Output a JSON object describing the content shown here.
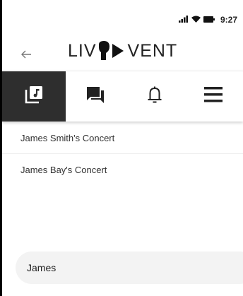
{
  "status_bar": {
    "time": "9:27",
    "signal_icon": "signal-icon",
    "wifi_icon": "wifi-icon",
    "battery_icon": "battery-icon"
  },
  "header": {
    "back_icon": "arrow-left-icon",
    "logo_left": "LIV",
    "logo_right": "VENT"
  },
  "tabs": [
    {
      "icon": "music-library-icon",
      "active": true
    },
    {
      "icon": "chat-icon",
      "active": false
    },
    {
      "icon": "bell-icon",
      "active": false
    },
    {
      "icon": "menu-icon",
      "active": false
    }
  ],
  "results": [
    {
      "label": "James Smith's Concert"
    },
    {
      "label": "James Bay's Concert"
    }
  ],
  "search": {
    "value": "James"
  },
  "colors": {
    "active_tab": "#2e2e2e",
    "logo_accent": "#111111"
  }
}
